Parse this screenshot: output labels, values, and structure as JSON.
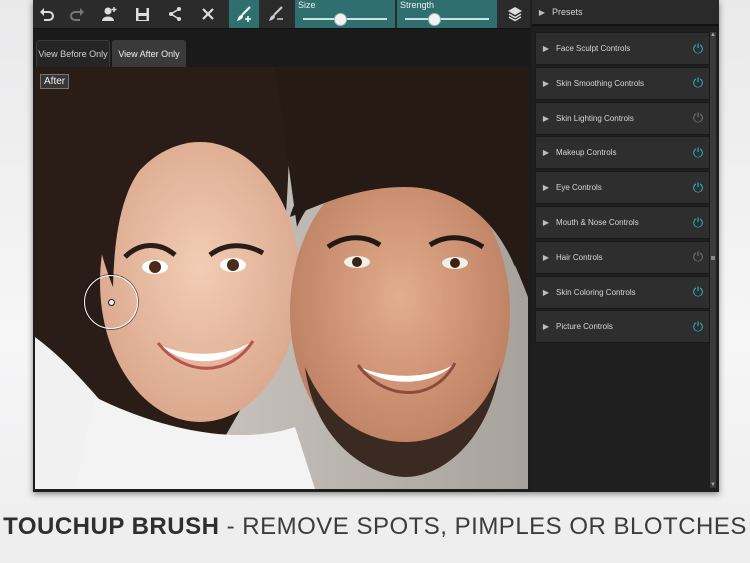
{
  "toolbar": {
    "undo_icon": "undo-icon",
    "redo_icon": "redo-icon",
    "add_user_icon": "add-user-icon",
    "save_icon": "save-icon",
    "share_icon": "share-icon",
    "close_icon": "close-icon",
    "touchup_brush_icon": "brush-plus-icon",
    "eraser_brush_icon": "brush-minus-icon",
    "layers_icon": "layers-icon",
    "size_label": "Size",
    "size_value": 0.44,
    "strength_label": "Strength",
    "strength_value": 0.35
  },
  "tabs": [
    {
      "label": "View Before Only"
    },
    {
      "label": "View After Only"
    }
  ],
  "photo": {
    "overlay_label": "After"
  },
  "panel": {
    "presets_label": "Presets",
    "controls": [
      {
        "label": "Face Sculpt Controls",
        "enabled": true
      },
      {
        "label": "Skin Smoothing Controls",
        "enabled": true
      },
      {
        "label": "Skin Lighting Controls",
        "enabled": false
      },
      {
        "label": "Makeup Controls",
        "enabled": true
      },
      {
        "label": "Eye Controls",
        "enabled": true
      },
      {
        "label": "Mouth & Nose Controls",
        "enabled": true
      },
      {
        "label": "Hair Controls",
        "enabled": false
      },
      {
        "label": "Skin Coloring Controls",
        "enabled": true
      },
      {
        "label": "Picture Controls",
        "enabled": true
      }
    ]
  },
  "caption": {
    "bold": "TOUCHUP BRUSH",
    "rest": " - REMOVE SPOTS, PIMPLES OR BLOTCHES"
  },
  "colors": {
    "accent": "#2f6f70",
    "power_on": "#35b6c9",
    "power_off": "#7a7a7a"
  }
}
